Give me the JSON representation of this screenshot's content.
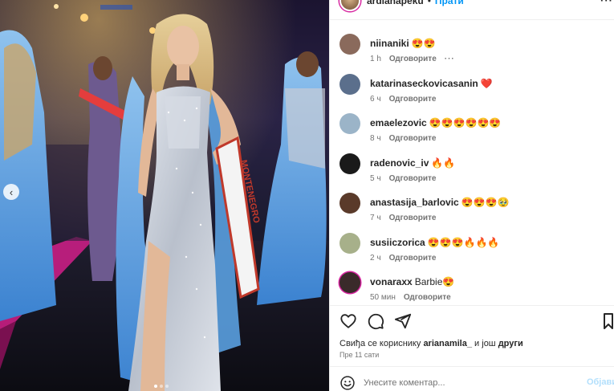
{
  "post": {
    "username": "ardianapeku",
    "separator": "•",
    "follow_label": "Прати",
    "more_label": "···"
  },
  "comments": [
    {
      "user": "niinaniki",
      "text": "😍😍",
      "time": "1 h",
      "reply": "Одговорите",
      "more": "···",
      "avatar_color": "#8a6a5c"
    },
    {
      "user": "katarinaseckovicasanin",
      "text": "❤️",
      "time": "6 ч",
      "reply": "Одговорите",
      "avatar_color": "#5b6f8c"
    },
    {
      "user": "emaelezovic",
      "text": "😍😍😍😍😍😍",
      "time": "8 ч",
      "reply": "Одговорите",
      "avatar_color": "#9bb4c8"
    },
    {
      "user": "radenovic_iv",
      "text": "🔥🔥",
      "time": "5 ч",
      "reply": "Одговорите",
      "avatar_color": "#1a1a1a"
    },
    {
      "user": "anastasija_barlovic",
      "text": "😍😍😍🥹",
      "time": "7 ч",
      "reply": "Одговорите",
      "avatar_color": "#5a3a2a"
    },
    {
      "user": "susiiczorica",
      "text": "😍😍😍🔥🔥🔥",
      "time": "2 ч",
      "reply": "Одговорите",
      "avatar_color": "#a7b08a"
    },
    {
      "user": "vonaraxx",
      "text": "Barbie😍",
      "time": "50 мин",
      "reply": "Одговорите",
      "avatar_color": "#3a2a2a"
    }
  ],
  "likes": {
    "prefix": "Свиђа се кориснику",
    "user": "arianamila_",
    "middle": "и још",
    "others": "други"
  },
  "posted_ago": "Пре 11 сати",
  "comment_input": {
    "placeholder": "Унесите коментар...",
    "publish_label": "Објави"
  },
  "sash": {
    "text": "MONTENEGRO"
  },
  "colors": {
    "link": "#0095f6",
    "heart": "#ed4956",
    "muted": "#737373",
    "dress_blue": "#4a90d9"
  }
}
